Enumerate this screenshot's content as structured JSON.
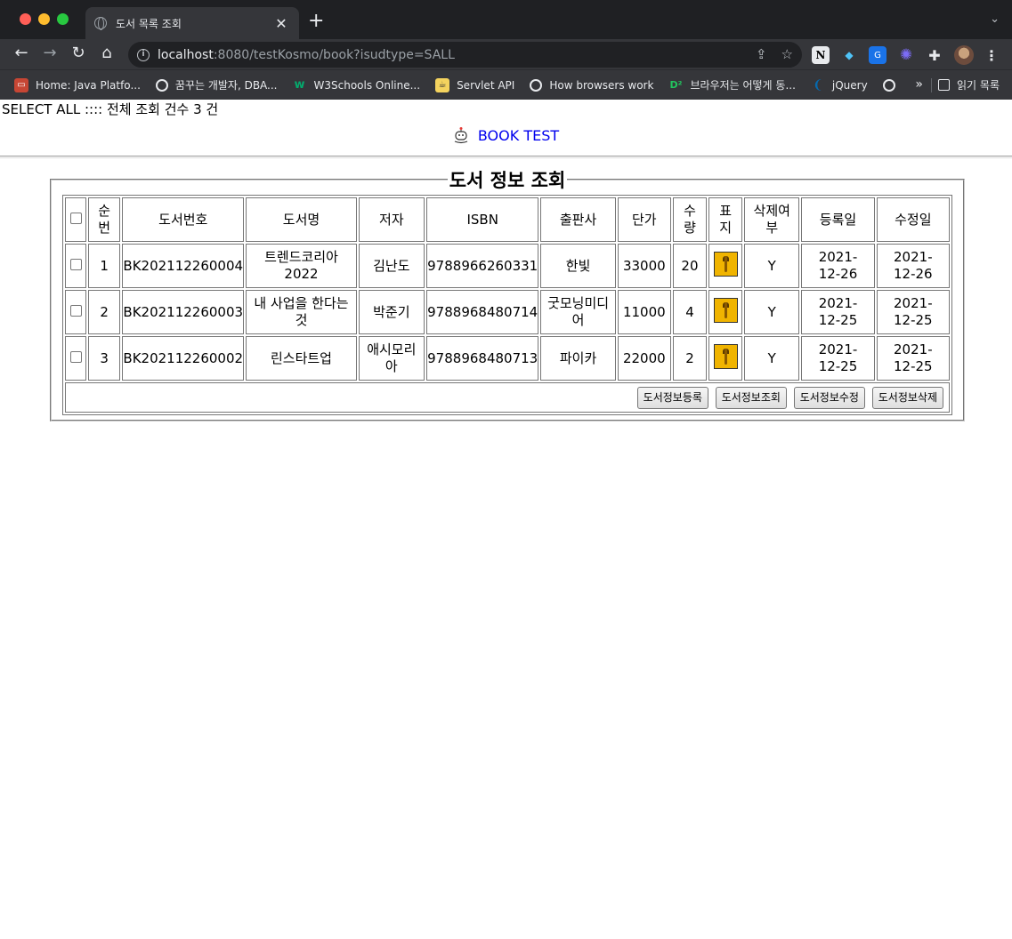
{
  "browser": {
    "tab_title": "도서 목록 조회",
    "url_host": "localhost",
    "url_rest": ":8080/testKosmo/book?isudtype=SALL",
    "bookmarks": [
      {
        "label": "Home: Java Platfo...",
        "icon": "oracle-icon"
      },
      {
        "label": "꿈꾸는 개발자, DBA...",
        "icon": "globe-icon"
      },
      {
        "label": "W3Schools Online...",
        "icon": "w3schools-icon"
      },
      {
        "label": "Servlet API",
        "icon": "servlet-icon"
      },
      {
        "label": "How browsers work",
        "icon": "globe-icon"
      },
      {
        "label": "브라우저는 어떻게 동...",
        "icon": "d2-icon"
      },
      {
        "label": "jQuery",
        "icon": "jquery-icon"
      }
    ],
    "more": "»",
    "reading_list": "읽기 목록"
  },
  "page": {
    "select_all_text": "SELECT ALL :::: 전체 조회 건수 3 건",
    "brand": "BOOK TEST",
    "legend": "도서 정보 조회"
  },
  "table": {
    "headers": [
      "",
      "순번",
      "도서번호",
      "도서명",
      "저자",
      "ISBN",
      "출판사",
      "단가",
      "수량",
      "표지",
      "삭제여부",
      "등록일",
      "수정일"
    ],
    "rows": [
      {
        "seq": "1",
        "id": "BK202112260004",
        "title": "트렌드코리아 2022",
        "author": "김난도",
        "isbn": "9788966260331",
        "publisher": "한빛",
        "price": "33000",
        "qty": "20",
        "deleted": "Y",
        "reg": "2021-12-26",
        "mod": "2021-12-26"
      },
      {
        "seq": "2",
        "id": "BK202112260003",
        "title": "내 사업을 한다는 것",
        "author": "박준기",
        "isbn": "9788968480714",
        "publisher": "굿모닝미디어",
        "price": "11000",
        "qty": "4",
        "deleted": "Y",
        "reg": "2021-12-25",
        "mod": "2021-12-25"
      },
      {
        "seq": "3",
        "id": "BK202112260002",
        "title": "린스타트업",
        "author": "애시모리아",
        "isbn": "9788968480713",
        "publisher": "파이카",
        "price": "22000",
        "qty": "2",
        "deleted": "Y",
        "reg": "2021-12-25",
        "mod": "2021-12-25"
      }
    ],
    "buttons": [
      "도서정보등록",
      "도서정보조회",
      "도서정보수정",
      "도서정보삭제"
    ]
  }
}
